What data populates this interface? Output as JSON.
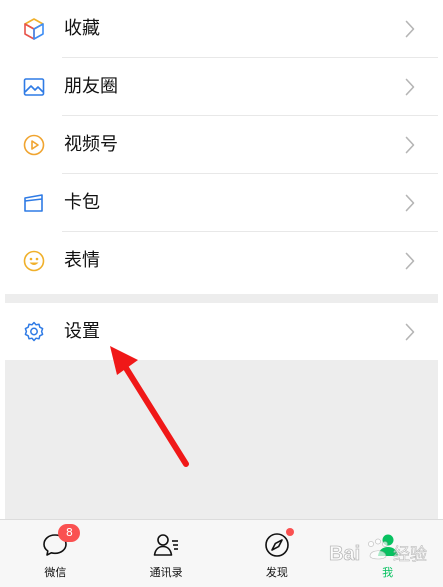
{
  "menu_group_1": [
    {
      "label": "收藏",
      "icon": "favorites-cube-icon"
    },
    {
      "label": "朋友圈",
      "icon": "moments-photo-icon"
    },
    {
      "label": "视频号",
      "icon": "channels-play-icon"
    },
    {
      "label": "卡包",
      "icon": "card-wallet-icon"
    },
    {
      "label": "表情",
      "icon": "sticker-smiley-icon"
    }
  ],
  "menu_group_2": [
    {
      "label": "设置",
      "icon": "settings-gear-icon"
    }
  ],
  "tabbar": {
    "tabs": [
      {
        "label": "微信",
        "icon": "chats-bubble-icon",
        "badge": "8"
      },
      {
        "label": "通讯录",
        "icon": "contacts-person-icon"
      },
      {
        "label": "发现",
        "icon": "discover-compass-icon",
        "dot": true
      },
      {
        "label": "我",
        "icon": "me-person-icon",
        "active": true
      }
    ]
  },
  "watermark": {
    "text": "Bai 经验"
  },
  "colors": {
    "accent_green": "#07c160",
    "badge_red": "#fa5151",
    "annotation_arrow": "#f01818",
    "background_gray": "#ededed"
  }
}
